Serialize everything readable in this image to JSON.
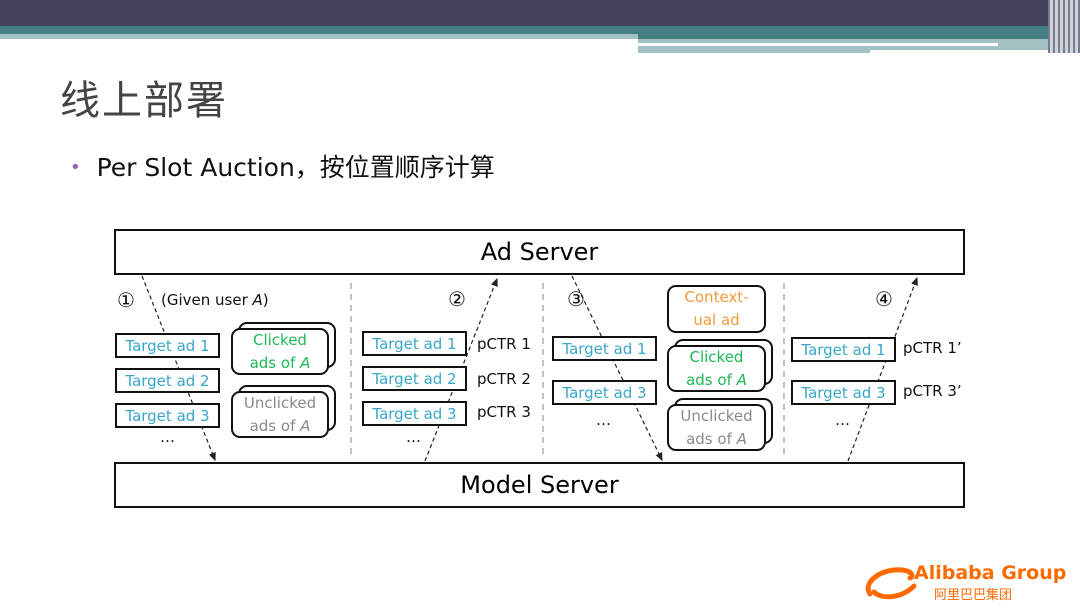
{
  "slide": {
    "title": "线上部署",
    "bullet": "Per Slot Auction，按位置顺序计算"
  },
  "diagram": {
    "ad_server": "Ad Server",
    "model_server": "Model Server",
    "steps": [
      "①",
      "②",
      "③",
      "④"
    ],
    "given_user": "(Given user ",
    "user": "A",
    "target_ads": [
      "Target ad 1",
      "Target ad 2",
      "Target ad 3"
    ],
    "ellipsis": "…",
    "clicked": "Clicked",
    "unclicked": "Unclicked",
    "ads_of": "ads of ",
    "contextual_1": "Context-",
    "contextual_2": "ual ad",
    "pctr": [
      "pCTR 1",
      "pCTR 2",
      "pCTR 3"
    ],
    "pctr_prime": [
      "pCTR 1’",
      "pCTR 3’"
    ]
  },
  "logo": {
    "text": "Alibaba Group",
    "cn": "阿里巴巴集团"
  },
  "colors": {
    "header_dark": "#42435a",
    "header_teal": "#437f82",
    "target": "#3aa7c9",
    "clicked": "#1db954",
    "unclicked": "#8a8a8a",
    "contextual": "#f39a3c",
    "brand": "#ff6a00"
  }
}
